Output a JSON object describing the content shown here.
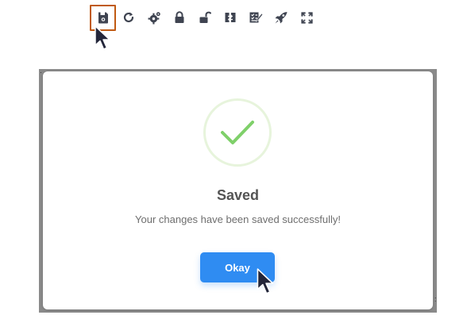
{
  "toolbar": {
    "items": [
      {
        "icon": "save-icon",
        "state": "highlighted"
      },
      {
        "icon": "refresh-icon"
      },
      {
        "icon": "settings-icon"
      },
      {
        "icon": "lock-icon"
      },
      {
        "icon": "unlock-icon"
      },
      {
        "icon": "import-icon"
      },
      {
        "icon": "checklist-icon"
      },
      {
        "icon": "rocket-icon"
      },
      {
        "icon": "fullscreen-icon"
      }
    ],
    "highlight_color": "#c05a12",
    "icon_color": "#3f4451"
  },
  "modal": {
    "title": "Saved",
    "message": "Your changes have been saved successfully!",
    "ok_label": "Okay",
    "success_color": "#7fd06a",
    "button_color": "#2f8cf2"
  },
  "backdrop": {
    "color": "#8a8a8a"
  }
}
